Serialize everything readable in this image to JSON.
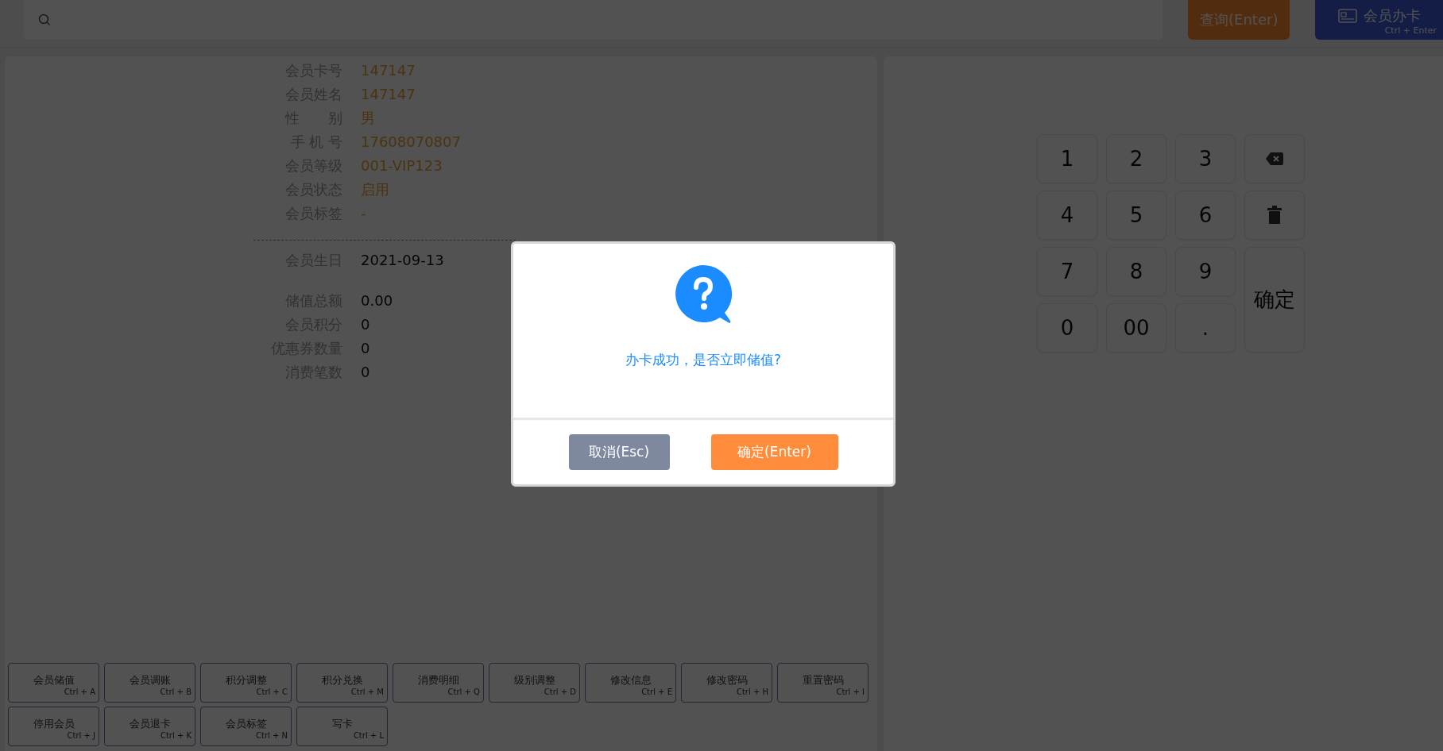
{
  "top_bar": {
    "query_button": "查询(Enter)",
    "card_button": {
      "label": "会员办卡",
      "shortcut": "Ctrl + Enter"
    }
  },
  "member_info": {
    "profile": [
      {
        "label": "会员卡号",
        "value": "147147"
      },
      {
        "label": "会员姓名",
        "value": "147147"
      },
      {
        "label": "性　　别",
        "value": "男"
      },
      {
        "label": "手 机 号",
        "value": "17608070807"
      },
      {
        "label": "会员等级",
        "value": "001-VIP123"
      },
      {
        "label": "会员状态",
        "value": "启用"
      },
      {
        "label": "会员标签",
        "value": "-"
      }
    ],
    "birthday": {
      "label": "会员生日",
      "value": "2021-09-13"
    },
    "stats": [
      {
        "label": "储值总额",
        "value": "0.00"
      },
      {
        "label": "会员积分",
        "value": "0"
      },
      {
        "label": "优惠券数量",
        "value": "0"
      },
      {
        "label": "消费笔数",
        "value": "0"
      }
    ]
  },
  "actions": [
    {
      "label": "会员储值",
      "shortcut": "Ctrl + A"
    },
    {
      "label": "会员调账",
      "shortcut": "Ctrl + B"
    },
    {
      "label": "积分调整",
      "shortcut": "Ctrl + C"
    },
    {
      "label": "积分兑换",
      "shortcut": "Ctrl + M"
    },
    {
      "label": "消费明细",
      "shortcut": "Ctrl + Q"
    },
    {
      "label": "级别调整",
      "shortcut": "Ctrl + D"
    },
    {
      "label": "修改信息",
      "shortcut": "Ctrl + E"
    },
    {
      "label": "修改密码",
      "shortcut": "Ctrl + H"
    },
    {
      "label": "重置密码",
      "shortcut": "Ctrl + I"
    },
    {
      "label": "停用会员",
      "shortcut": "Ctrl + J"
    },
    {
      "label": "会员退卡",
      "shortcut": "Ctrl + K"
    },
    {
      "label": "会员标签",
      "shortcut": "Ctrl + N"
    },
    {
      "label": "写卡",
      "shortcut": "Ctrl + L"
    }
  ],
  "keypad": [
    {
      "kind": "digit",
      "label": "1"
    },
    {
      "kind": "digit",
      "label": "2"
    },
    {
      "kind": "digit",
      "label": "3"
    },
    {
      "kind": "backspace"
    },
    {
      "kind": "digit",
      "label": "4"
    },
    {
      "kind": "digit",
      "label": "5"
    },
    {
      "kind": "digit",
      "label": "6"
    },
    {
      "kind": "clear"
    },
    {
      "kind": "digit",
      "label": "7"
    },
    {
      "kind": "digit",
      "label": "8"
    },
    {
      "kind": "digit",
      "label": "9"
    },
    {
      "kind": "confirm",
      "label": "确定"
    },
    {
      "kind": "digit",
      "label": "0"
    },
    {
      "kind": "digit",
      "label": "00"
    },
    {
      "kind": "digit",
      "label": "."
    }
  ],
  "dialog": {
    "message": "办卡成功，是否立即储值?",
    "cancel_button": "取消(Esc)",
    "ok_button": "确定(Enter)"
  }
}
